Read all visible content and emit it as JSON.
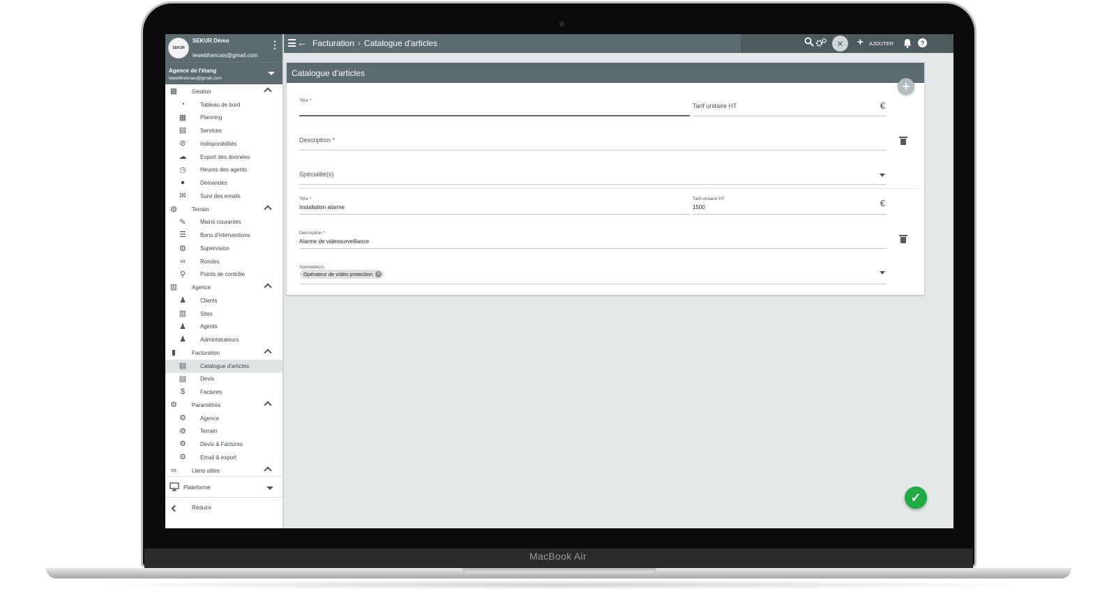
{
  "device": {
    "brand": "MacBook Air"
  },
  "sidebar": {
    "user": {
      "avatar_text": "SEKUR",
      "name": "SEKUR Démo",
      "email": "lewebfrancais@gmail.com"
    },
    "agency": {
      "name": "Agence de l'étang",
      "email": "lewebfrancais@gmail.com"
    },
    "sections": [
      {
        "label": "Gestion",
        "icon": "calendar-icon",
        "items": [
          {
            "label": "Tableau de bord",
            "icon": "dashboard-gauge-icon"
          },
          {
            "label": "Planning",
            "icon": "calendar-icon"
          },
          {
            "label": "Services",
            "icon": "clipboard-icon"
          },
          {
            "label": "Indisponibilités",
            "icon": "user-slash-icon"
          },
          {
            "label": "Export des données",
            "icon": "cloud-download-icon"
          },
          {
            "label": "Heures des agents",
            "icon": "user-clock-icon"
          },
          {
            "label": "Demandes",
            "icon": "chat-bubble-icon"
          },
          {
            "label": "Suivi des emails",
            "icon": "envelope-icon"
          }
        ]
      },
      {
        "label": "Terrain",
        "icon": "compass-icon",
        "items": [
          {
            "label": "Mains courantes",
            "icon": "pen-icon"
          },
          {
            "label": "Bons d'interventions",
            "icon": "checklist-icon"
          },
          {
            "label": "Supervision",
            "icon": "compass-icon"
          },
          {
            "label": "Rondes",
            "icon": "route-icon"
          },
          {
            "label": "Points de contrôle",
            "icon": "map-marker-icon"
          }
        ]
      },
      {
        "label": "Agence",
        "icon": "city-icon",
        "items": [
          {
            "label": "Clients",
            "icon": "user-tie-icon"
          },
          {
            "label": "Sites",
            "icon": "building-icon"
          },
          {
            "label": "Agents",
            "icon": "user-shield-icon"
          },
          {
            "label": "Administrateurs",
            "icon": "user-cog-icon"
          }
        ]
      },
      {
        "label": "Facturation",
        "icon": "file-icon",
        "items": [
          {
            "label": "Catalogue d'articles",
            "icon": "list-alt-icon",
            "active": true
          },
          {
            "label": "Devis",
            "icon": "file-text-icon"
          },
          {
            "label": "Factures",
            "icon": "file-invoice-dollar-icon"
          }
        ]
      },
      {
        "label": "Paramètres",
        "icon": "cogs-icon",
        "items": [
          {
            "label": "Agence",
            "icon": "gear-icon"
          },
          {
            "label": "Terrain",
            "icon": "gear-icon"
          },
          {
            "label": "Devis & Factures",
            "icon": "gear-icon"
          },
          {
            "label": "Email & export",
            "icon": "gear-icon"
          }
        ]
      },
      {
        "label": "Liens utiles",
        "icon": "link-icon",
        "items": []
      }
    ],
    "platform_label": "Plateforme",
    "reduce_label": "Réduire"
  },
  "topbar": {
    "breadcrumb": [
      "Facturation",
      "Catalogue d'articles"
    ],
    "add_label": "AJOUTER"
  },
  "card": {
    "title": "Catalogue d'articles",
    "new_item": {
      "title_label": "Titre *",
      "title_value": "",
      "price_placeholder": "Tarif unitaire HT",
      "description_placeholder": "Description *",
      "specialty_placeholder": "Spécialité(s)"
    },
    "items": [
      {
        "title_label": "Titre *",
        "title_value": "Installation alarme",
        "price_label": "Tarif unitaire HT",
        "price_value": "1500",
        "description_label": "Description *",
        "description_value": "Alarme de videosurveillance",
        "specialty_label": "Spécialité(s)",
        "specialties": [
          "Opérateur de vidéo protection"
        ]
      }
    ],
    "currency_symbol": "€"
  },
  "colors": {
    "primary": "#5b6b70",
    "topbar_dark": "#4d5b5f",
    "success": "#1faa43",
    "background": "#e4e8e9"
  }
}
